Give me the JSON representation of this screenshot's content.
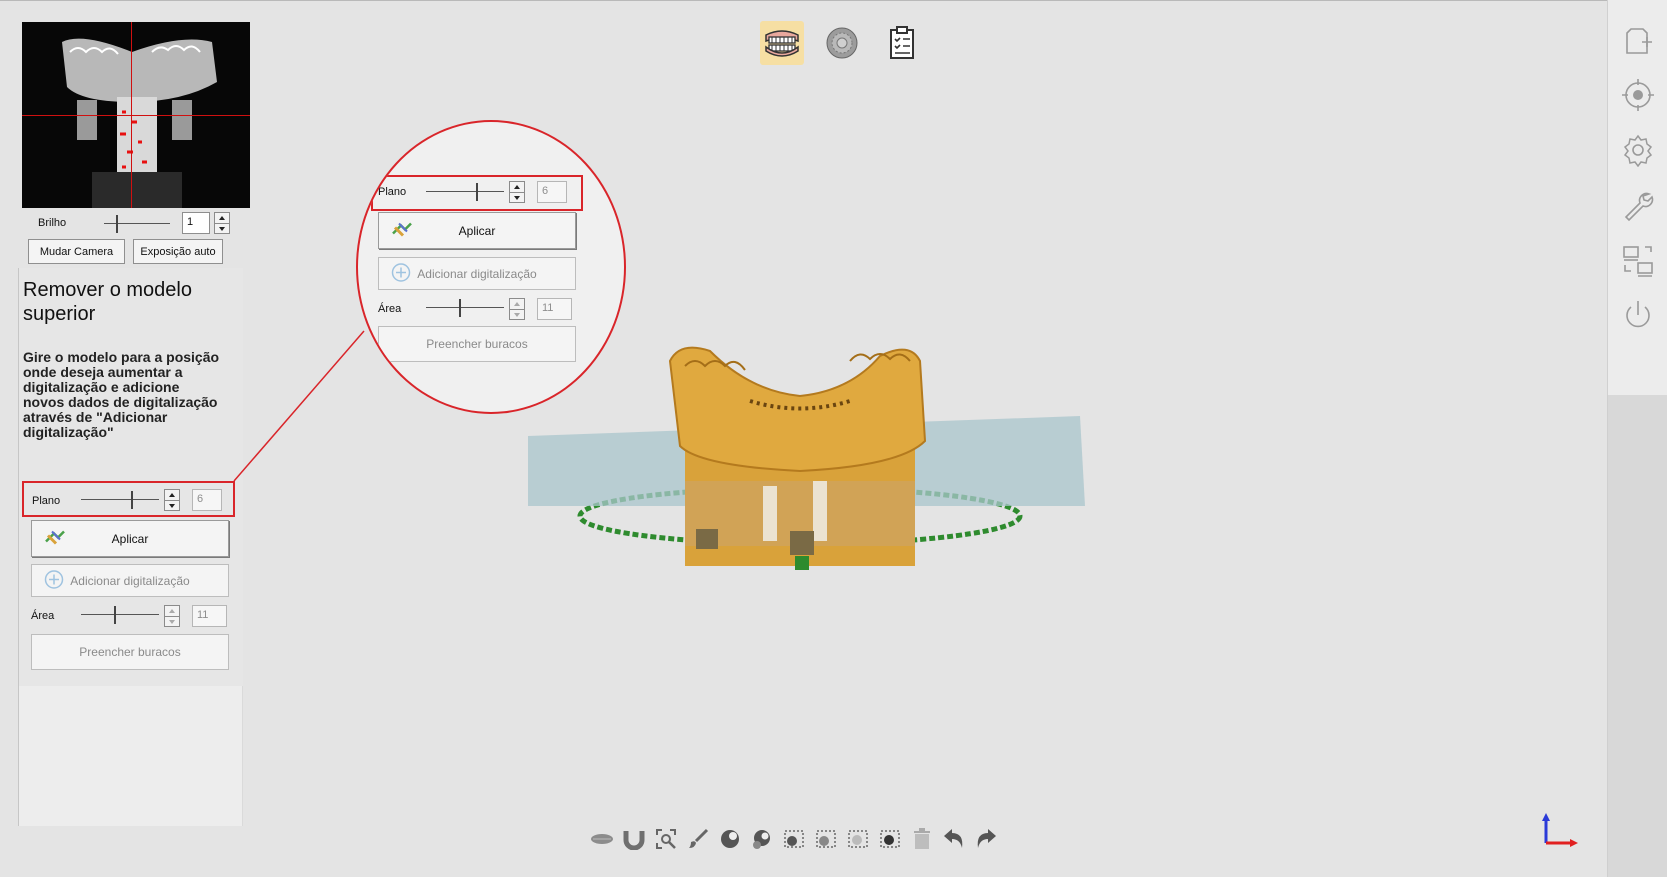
{
  "colors": {
    "accent_red": "#d9252a",
    "model_yellow": "#d9a23a",
    "plane_blue": "#a9c6cc",
    "active_mode": "#f6dfa3"
  },
  "top_modes": [
    {
      "icon": "jaw-teeth-icon",
      "active": true
    },
    {
      "icon": "scan-disc-icon",
      "active": false
    },
    {
      "icon": "report-clipboard-icon",
      "active": false
    }
  ],
  "right_toolbar": [
    "new-file-icon",
    "target-icon",
    "settings-gear-icon",
    "wrench-icon",
    "screen-layout-icon",
    "power-icon"
  ],
  "camera": {
    "brightness_label": "Brilho",
    "brightness_value": "1",
    "change_camera_label": "Mudar Camera",
    "auto_exposure_label": "Exposição auto"
  },
  "instructions": {
    "title": "Remover o modelo superior",
    "body": "Gire o modelo para a posição onde deseja aumentar a digitalização e adicione novos dados de digitalização através de \"Adicionar digitalização\""
  },
  "controls": {
    "plane_label": "Plano",
    "plane_value": "6",
    "apply_label": "Aplicar",
    "add_scan_label": "Adicionar digitalização",
    "area_label": "Área",
    "area_value": "11",
    "fill_holes_label": "Preencher buracos"
  },
  "bottom_toolbar": [
    "jaw-mesh-icon",
    "arch-icon",
    "zoom-fit-icon",
    "brush-icon",
    "sphere-select-icon",
    "sphere-deselect-icon",
    "box-select-icon",
    "box-deselect-icon",
    "lasso-select-icon",
    "invert-select-icon",
    "trash-icon",
    "undo-icon",
    "redo-icon"
  ]
}
